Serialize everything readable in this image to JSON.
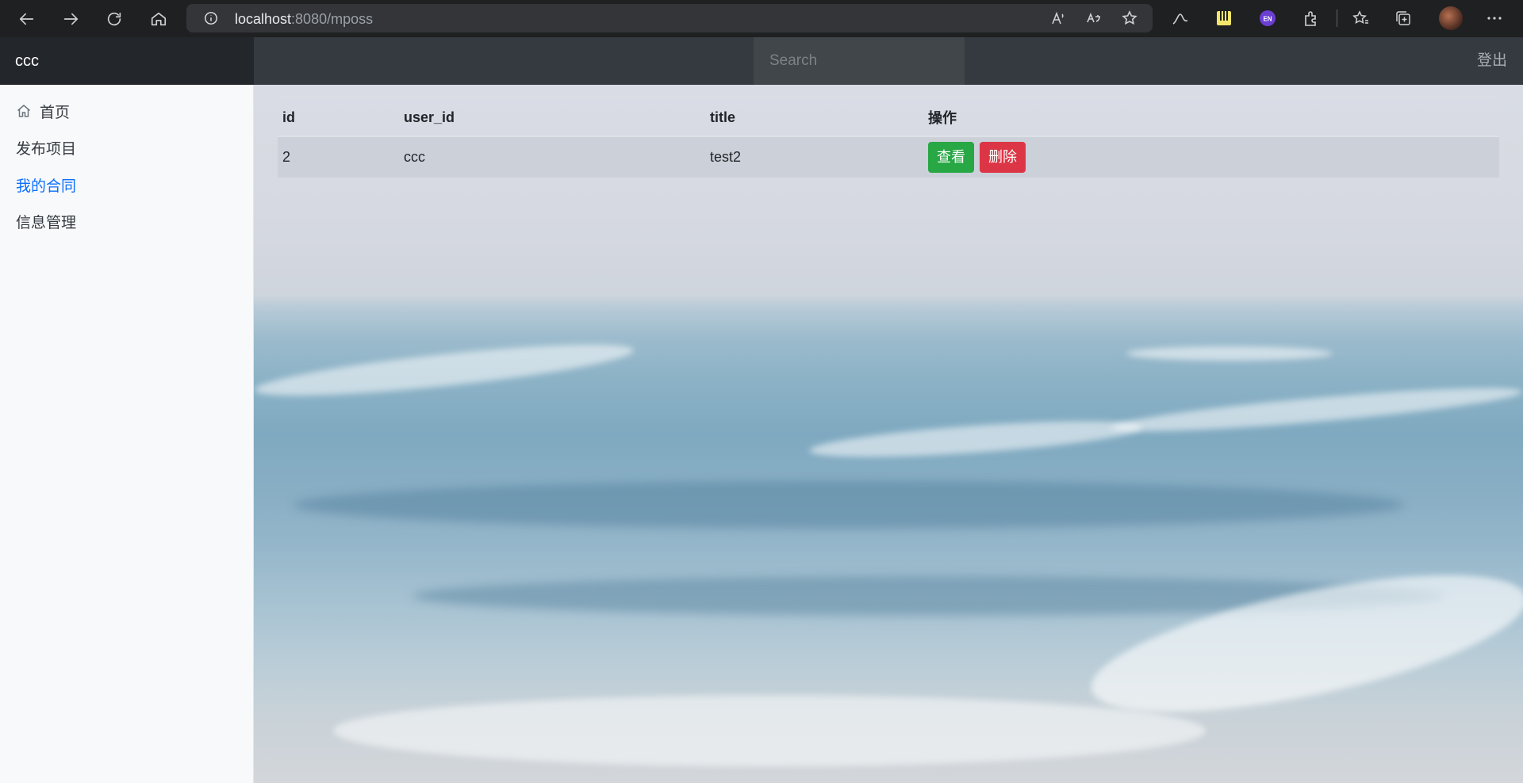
{
  "browser": {
    "url_host": "localhost",
    "url_rest": ":8080/mposs"
  },
  "header": {
    "brand": "ccc",
    "search_placeholder": "Search",
    "logout": "登出"
  },
  "sidebar": {
    "items": [
      {
        "label": "首页",
        "icon": "home-icon",
        "active": false
      },
      {
        "label": "发布项目",
        "active": false
      },
      {
        "label": "我的合同",
        "active": true
      },
      {
        "label": "信息管理",
        "active": false
      }
    ]
  },
  "table": {
    "columns": [
      "id",
      "user_id",
      "title",
      "操作"
    ],
    "rows": [
      {
        "id": "2",
        "user_id": "ccc",
        "title": "test2",
        "view_label": "查看",
        "delete_label": "删除"
      }
    ]
  },
  "colors": {
    "topbar": "#343a40",
    "brand_bg": "#23272b",
    "active_link": "#0d6efd",
    "view_button": "#28a745",
    "delete_button": "#dc3545"
  }
}
